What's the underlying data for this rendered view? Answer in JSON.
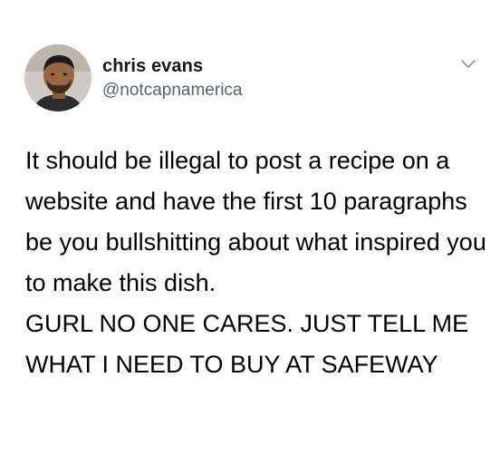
{
  "tweet": {
    "author": {
      "display_name": "chris evans",
      "handle": "@notcapnamerica",
      "avatar_icon": "profile-photo"
    },
    "menu_icon": "chevron-down-icon",
    "paragraphs": [
      "It should be illegal to post a recipe on a website and have the first 10 paragraphs be you bullshitting about what inspired you to make this dish.",
      "GURL NO ONE CARES.  JUST TELL ME WHAT I NEED TO BUY AT SAFEWAY"
    ]
  },
  "colors": {
    "background": "#ffffff",
    "text": "#000000",
    "handle": "#536471",
    "chevron": "#8899a6"
  }
}
